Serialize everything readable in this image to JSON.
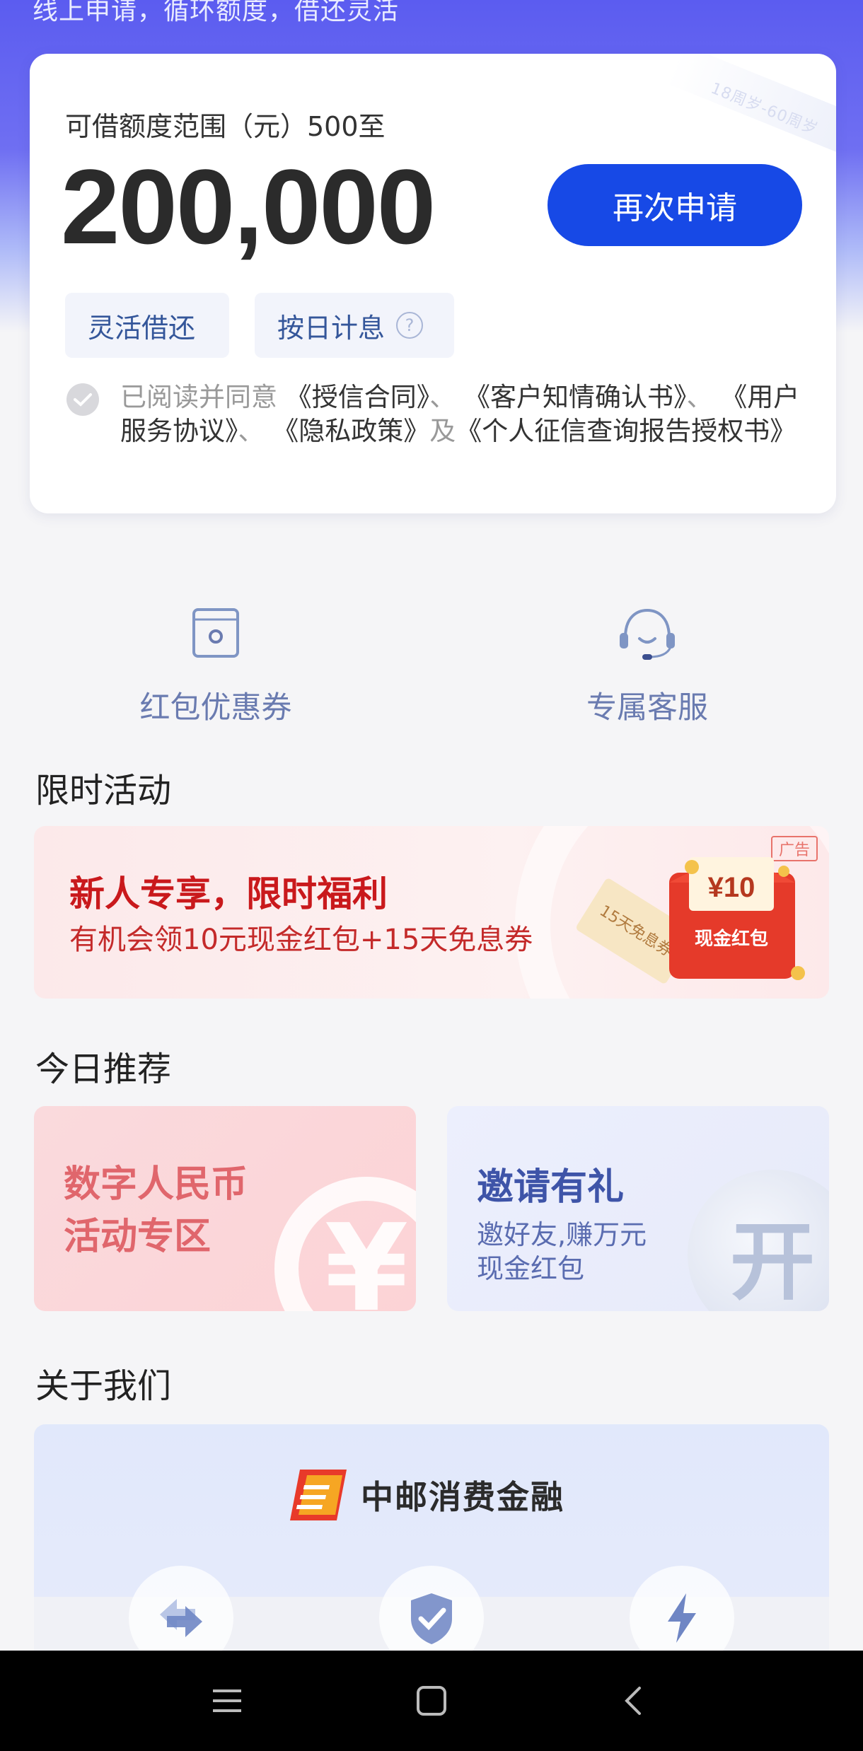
{
  "header": {
    "tagline": "线上申请，循环额度，借还灵活"
  },
  "credit": {
    "age_watermark": "18周岁-60周岁",
    "limit_label": "可借额度范围（元）500至",
    "limit_amount": "200,000",
    "apply_button": "再次申请",
    "tags": [
      "灵活借还",
      "按日计息"
    ],
    "agreement": {
      "prefix": "已阅读并同意",
      "doc1": "《授信合同》",
      "sep1": "、",
      "doc2": "《客户知情确认书》",
      "sep2": "、",
      "doc3": "《用户服务协议》",
      "sep3": "、",
      "doc4": "《隐私政策》",
      "conj": "及",
      "doc5": "《个人征信查询报告授权书》"
    }
  },
  "quick_links": [
    {
      "label": "红包优惠券",
      "icon": "coupon-icon"
    },
    {
      "label": "专属客服",
      "icon": "headset-icon"
    }
  ],
  "sections": {
    "promo_title": "限时活动",
    "recommend_title": "今日推荐",
    "about_title": "关于我们"
  },
  "promo": {
    "title": "新人专享，限时福利",
    "subtitle": "有机会领10元现金红包+15天免息券",
    "ad_label": "广告",
    "coupon_label": "15天免息券",
    "redpacket_amount": "¥10",
    "redpacket_label": "现金红包"
  },
  "recommend": [
    {
      "title_line1": "数字人民币",
      "title_line2": "活动专区",
      "icon_glyph": "¥"
    },
    {
      "title": "邀请有礼",
      "desc_line1": "邀好友,赚万元",
      "desc_line2": "现金红包",
      "icon_glyph": "开"
    }
  ],
  "about": {
    "brand": "中邮消费金融"
  },
  "colors": {
    "primary": "#1749e6",
    "hero_gradient_top": "#5b5cf0",
    "promo_red": "#c9191c",
    "rec_pink": "#e0666c",
    "rec_blue": "#3e54a8",
    "link_gray_blue": "#6a7bb0"
  }
}
